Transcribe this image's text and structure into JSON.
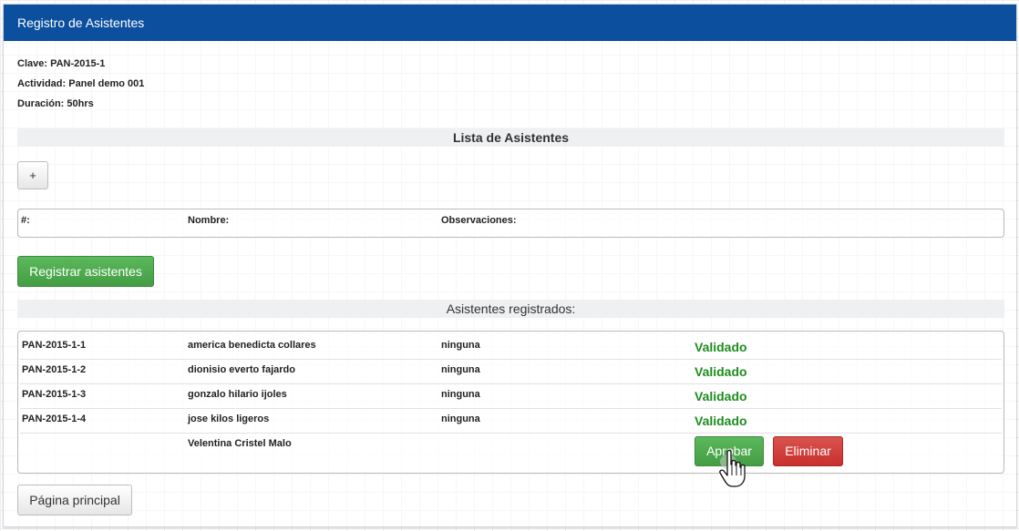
{
  "header": {
    "title": "Registro de Asistentes"
  },
  "info": {
    "clave": "Clave: PAN-2015-1",
    "actividad": "Actividad: Panel demo 001",
    "duracion": "Duración: 50hrs"
  },
  "lista": {
    "title": "Lista de Asistentes",
    "add_label": "+",
    "columns": {
      "num": "#:",
      "nombre": "Nombre:",
      "observaciones": "Observaciones:"
    },
    "register_label": "Registrar asistentes"
  },
  "registrados": {
    "title": "Asistentes registrados:",
    "rows": [
      {
        "id": "PAN-2015-1-1",
        "name": "america benedicta collares",
        "obs": "ninguna",
        "status": "Validado"
      },
      {
        "id": "PAN-2015-1-2",
        "name": "dionisio everto fajardo",
        "obs": "ninguna",
        "status": "Validado"
      },
      {
        "id": "PAN-2015-1-3",
        "name": "gonzalo hilario ijoles",
        "obs": "ninguna",
        "status": "Validado"
      },
      {
        "id": "PAN-2015-1-4",
        "name": "jose kilos ligeros",
        "obs": "ninguna",
        "status": "Validado"
      }
    ],
    "pending": {
      "id": "",
      "name": "Velentina Cristel Malo",
      "obs": "",
      "approve_label": "Aprobar",
      "delete_label": "Eliminar"
    }
  },
  "footer": {
    "home_label": "Página principal"
  },
  "colors": {
    "header": "#0b4f9e",
    "success": "#5cb85c",
    "danger": "#d9534f",
    "validated": "#1e8c1e"
  },
  "icons": {
    "cursor": "hand-pointer-icon"
  }
}
